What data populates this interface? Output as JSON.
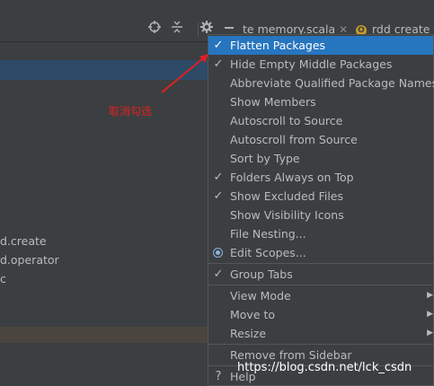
{
  "tabs": [
    {
      "label": "te memory.scala"
    },
    {
      "label": "rdd create t",
      "badge": "O"
    }
  ],
  "toolbar_icons": [
    "target-icon",
    "collapse-icon",
    "gear-icon",
    "minimize-icon"
  ],
  "tree_items": [
    {
      "label": "d.create"
    },
    {
      "label": "d.operator"
    },
    {
      "label": "c"
    }
  ],
  "annotation": {
    "text": "取消勾选",
    "color": "#e02020"
  },
  "menu": {
    "items": [
      {
        "label": "Flatten Packages",
        "checked": true,
        "selected": true
      },
      {
        "label": "Hide Empty Middle Packages",
        "checked": true
      },
      {
        "label": "Abbreviate Qualified Package Names"
      },
      {
        "label": "Show Members"
      },
      {
        "label": "Autoscroll to Source"
      },
      {
        "label": "Autoscroll from Source"
      },
      {
        "label": "Sort by Type"
      },
      {
        "label": "Folders Always on Top",
        "checked": true
      },
      {
        "label": "Show Excluded Files",
        "checked": true
      },
      {
        "label": "Show Visibility Icons"
      },
      {
        "label": "File Nesting..."
      },
      {
        "label": "Edit Scopes...",
        "radio": true
      },
      {
        "label": "Group Tabs",
        "checked": true
      },
      {
        "label": "View Mode",
        "submenu": true
      },
      {
        "label": "Move to",
        "submenu": true
      },
      {
        "label": "Resize",
        "submenu": true
      },
      {
        "label": "Remove from Sidebar"
      },
      {
        "label": "Help"
      }
    ]
  },
  "watermark": "https://blog.csdn.net/lck_csdn",
  "colors": {
    "selection": "#2675bf",
    "tree_selection": "#2d4a66",
    "background": "#3c3f41"
  }
}
